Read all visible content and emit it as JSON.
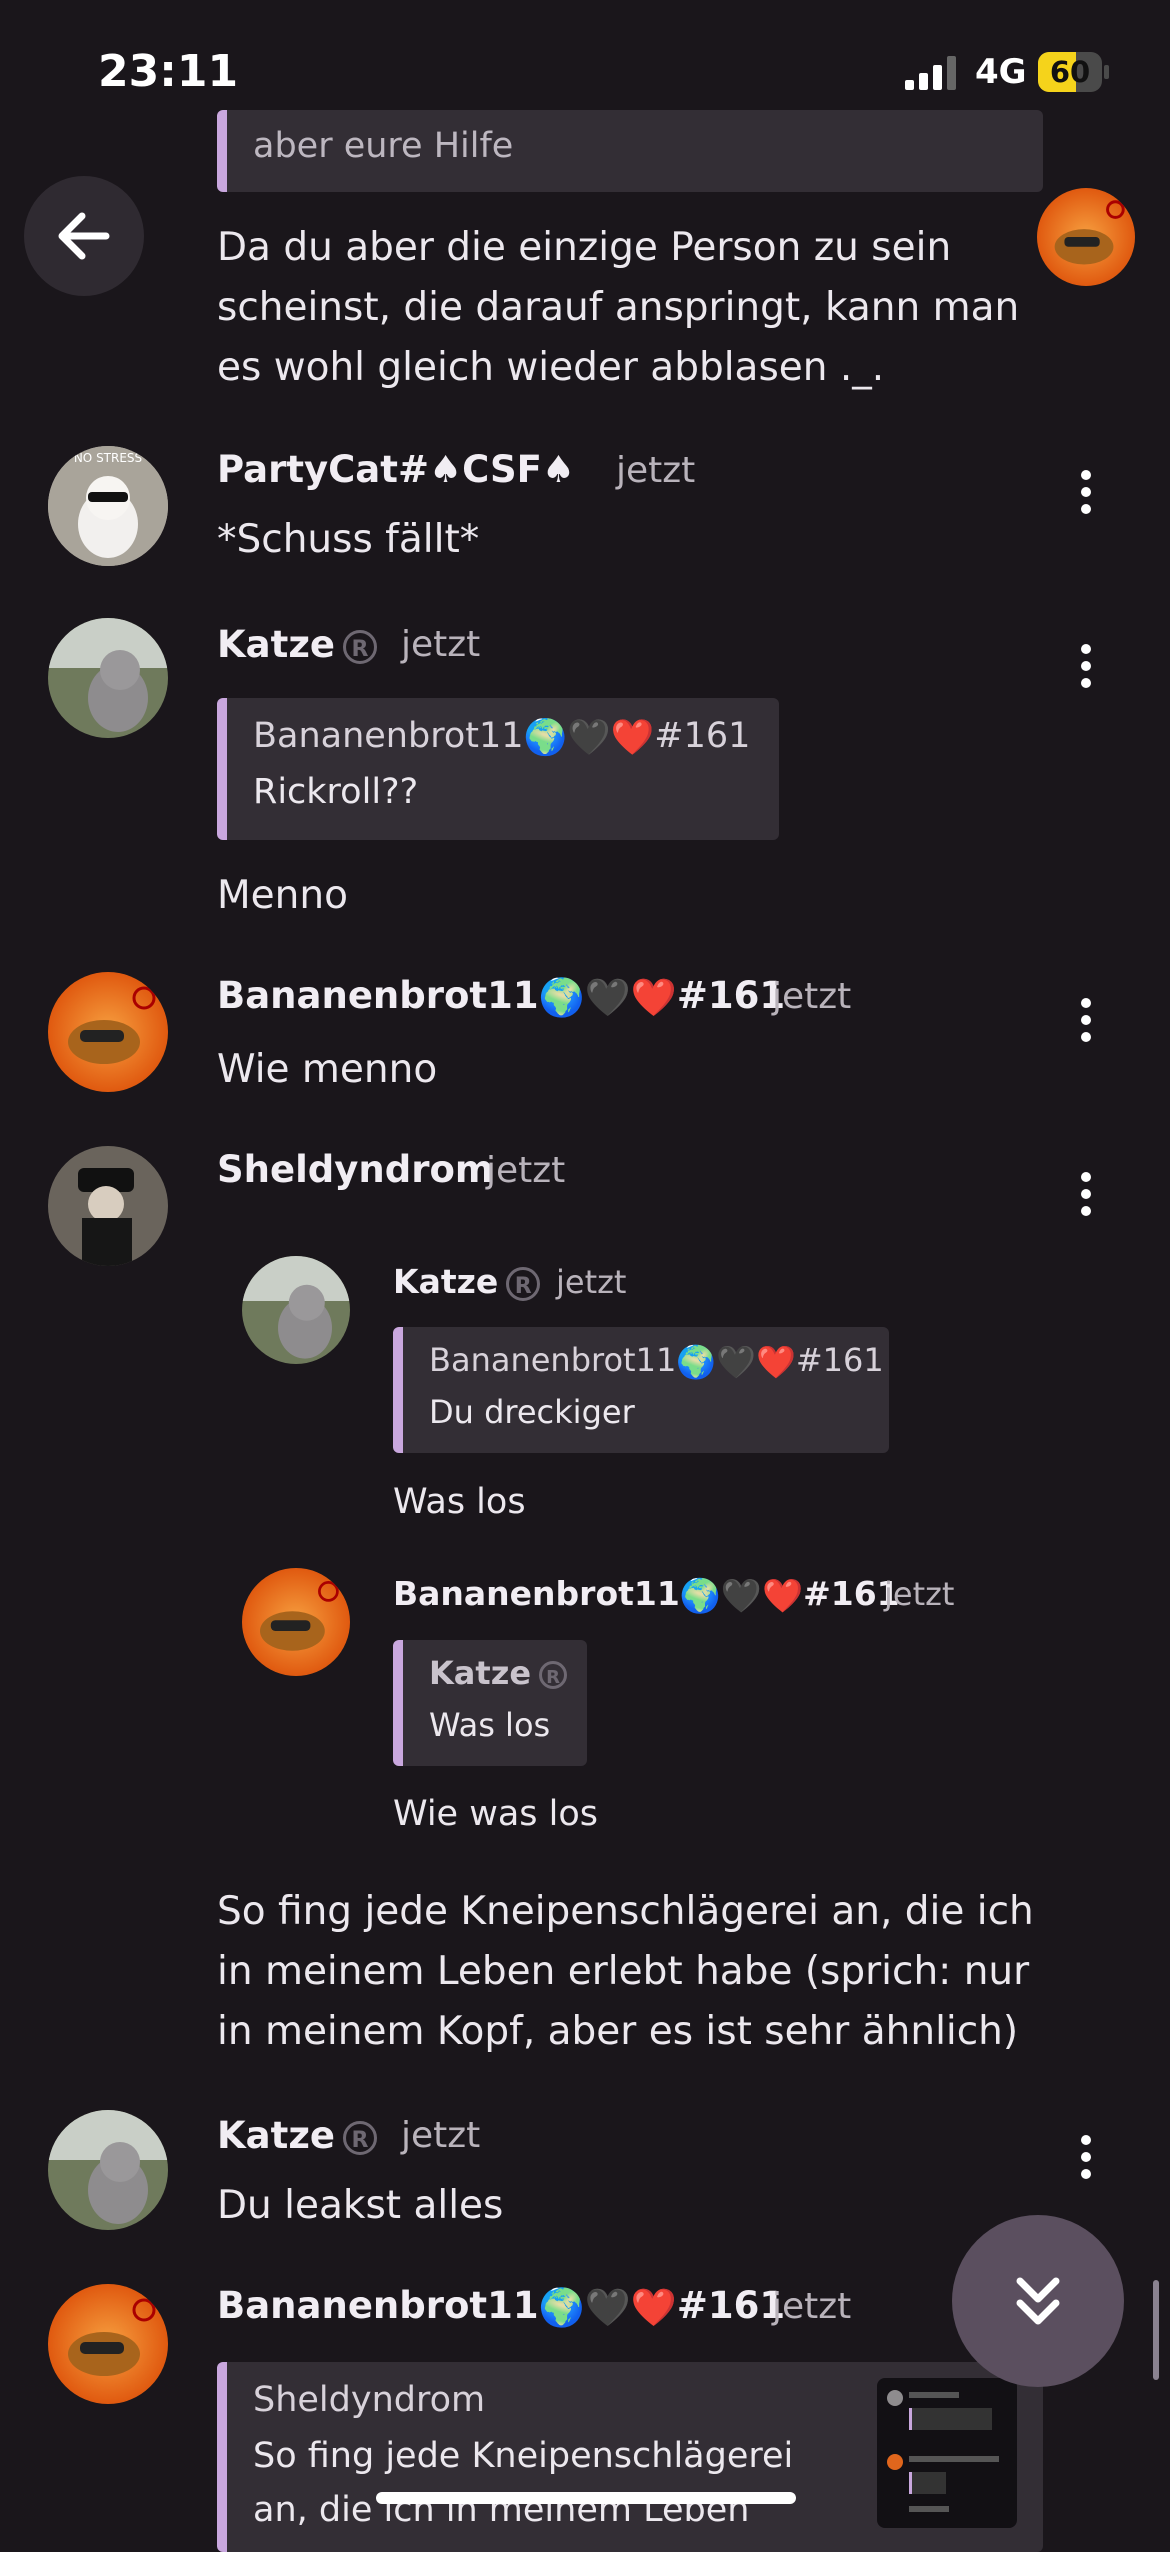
{
  "status_bar": {
    "time": "23:11",
    "network": "4G",
    "battery_percent": 60
  },
  "top_quote": {
    "text": "aber eure Hilfe"
  },
  "message_1": {
    "text": "Da du aber die einzige Person zu sein scheinst, die darauf anspringt, kann man es wohl gleich wieder abblasen ._."
  },
  "message_2": {
    "author": "PartyCat#♠CSF♠",
    "time": "jetzt",
    "text": "*Schuss fällt*"
  },
  "message_3": {
    "author": "Katze",
    "time": "jetzt",
    "quote_author": "Bananenbrot11",
    "quote_tag": "#161",
    "quote_text": "Rickroll??",
    "text": "Menno"
  },
  "message_4": {
    "author": "Bananenbrot11",
    "tag": "#161",
    "time": "jetzt",
    "text": "Wie menno"
  },
  "message_5": {
    "author": "Sheldyndrom",
    "time": "jetzt",
    "embed_1": {
      "author": "Katze",
      "time": "jetzt",
      "quote_author": "Bananenbrot11",
      "quote_tag": "#161",
      "quote_text": "Du dreckiger",
      "text": "Was los"
    },
    "embed_2": {
      "author": "Bananenbrot11",
      "tag": "#161",
      "time": "jetzt",
      "quote_author": "Katze",
      "quote_text": "Was los",
      "text": "Wie was los"
    },
    "text": "So fing jede Kneipenschlägerei an, die ich in meinem Leben erlebt habe (sprich: nur in meinem Kopf, aber es ist sehr ähnlich)"
  },
  "message_6": {
    "author": "Katze",
    "time": "jetzt",
    "text": "Du leakst alles"
  },
  "message_7": {
    "author": "Bananenbrot11",
    "tag": "#161",
    "time": "jetzt",
    "quote_author": "Sheldyndrom",
    "quote_text_line1": "So fing jede Kneipenschlägerei",
    "quote_text_line2": "an, die ich in meinem Leben"
  },
  "colors": {
    "background": "#1a161b",
    "quote_accent": "#c9a7de",
    "quote_bg": "#332e35",
    "fab": "#5b4f5f"
  }
}
